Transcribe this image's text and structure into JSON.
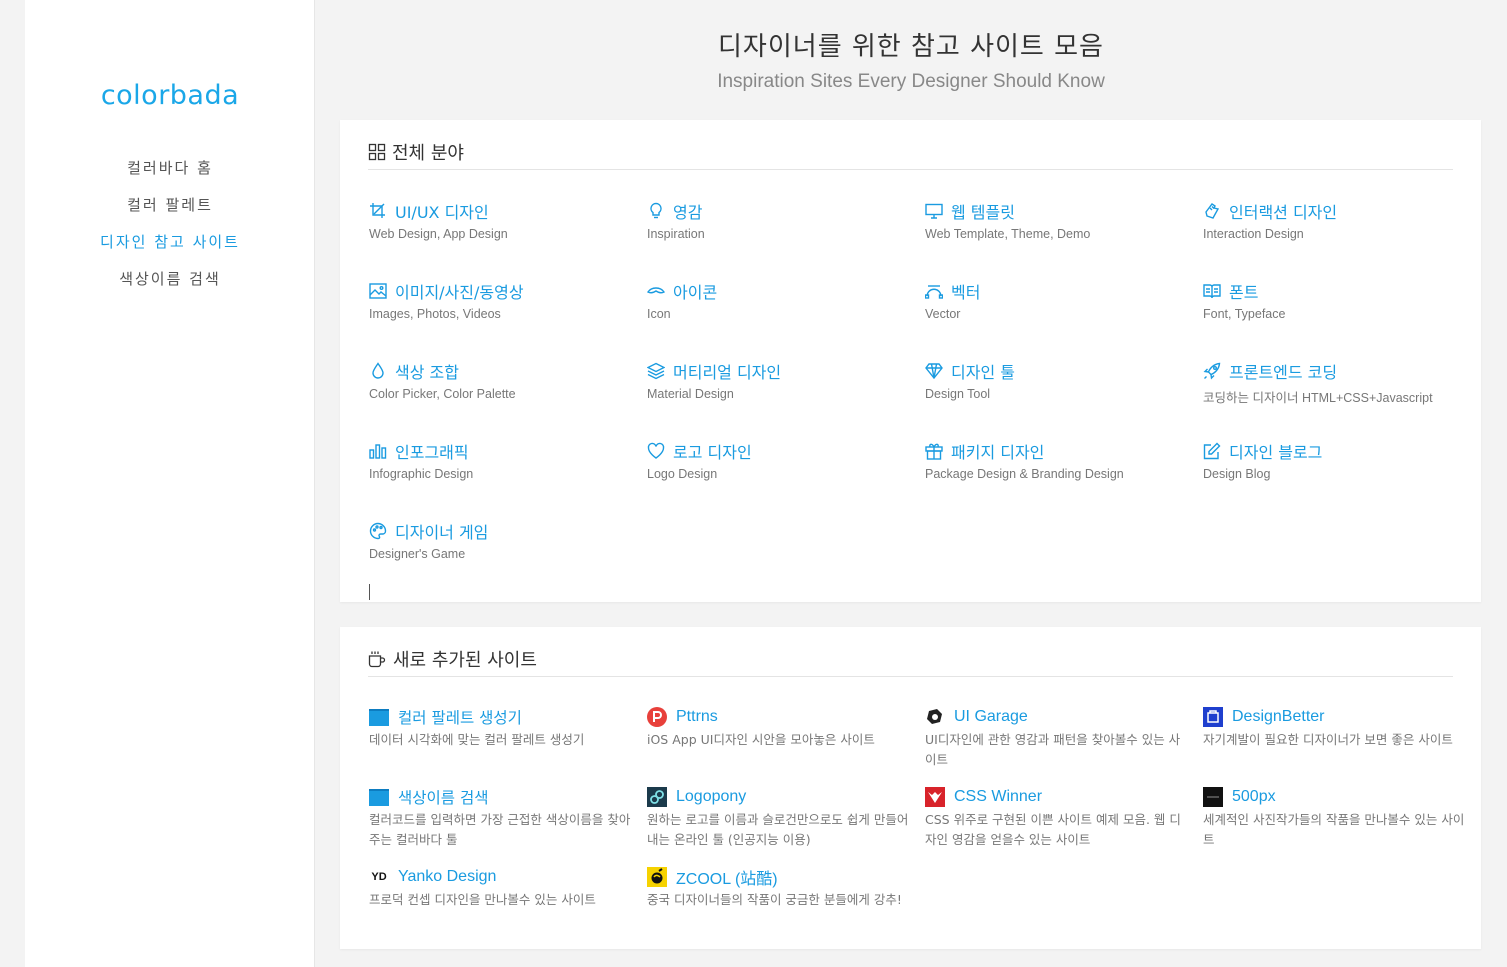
{
  "sidebar": {
    "logo": "colorbada",
    "nav": [
      {
        "label": "컬러바다 홈",
        "active": false
      },
      {
        "label": "컬러 팔레트",
        "active": false
      },
      {
        "label": "디자인 참고 사이트",
        "active": true
      },
      {
        "label": "색상이름 검색",
        "active": false
      }
    ]
  },
  "header": {
    "title": "디자이너를 위한 참고 사이트 모음",
    "subtitle": "Inspiration Sites Every Designer Should Know"
  },
  "categories": {
    "heading": "전체 분야",
    "items": [
      {
        "title": "UI/UX 디자인",
        "sub": "Web Design, App Design",
        "icon": "crop-icon"
      },
      {
        "title": "영감",
        "sub": "Inspiration",
        "icon": "lightbulb-icon"
      },
      {
        "title": "웹 템플릿",
        "sub": "Web Template, Theme, Demo",
        "icon": "monitor-icon"
      },
      {
        "title": "인터랙션 디자인",
        "sub": "Interaction Design",
        "icon": "hand-icon"
      },
      {
        "title": "이미지/사진/동영상",
        "sub": "Images, Photos, Videos",
        "icon": "image-icon"
      },
      {
        "title": "아이콘",
        "sub": "Icon",
        "icon": "eye-icon"
      },
      {
        "title": "벡터",
        "sub": "Vector",
        "icon": "bezier-icon"
      },
      {
        "title": "폰트",
        "sub": "Font, Typeface",
        "icon": "book-icon"
      },
      {
        "title": "색상 조합",
        "sub": "Color Picker, Color Palette",
        "icon": "drop-icon"
      },
      {
        "title": "머티리얼 디자인",
        "sub": "Material Design",
        "icon": "layers-icon"
      },
      {
        "title": "디자인 툴",
        "sub": "Design Tool",
        "icon": "diamond-icon"
      },
      {
        "title": "프론트엔드 코딩",
        "sub": "코딩하는 디자이너 HTML+CSS+Javascript",
        "icon": "rocket-icon"
      },
      {
        "title": "인포그래픽",
        "sub": "Infographic Design",
        "icon": "bar-chart-icon"
      },
      {
        "title": "로고 디자인",
        "sub": "Logo Design",
        "icon": "heart-icon"
      },
      {
        "title": "패키지 디자인",
        "sub": "Package Design & Branding Design",
        "icon": "gift-icon"
      },
      {
        "title": "디자인 블로그",
        "sub": "Design Blog",
        "icon": "edit-icon"
      },
      {
        "title": "디자이너 게임",
        "sub": "Designer's Game",
        "icon": "palette-icon"
      }
    ]
  },
  "new_sites": {
    "heading": "새로 추가된 사이트",
    "items": [
      {
        "title": "컬러 팔레트 생성기",
        "desc": "데이터 시각화에 맞는 컬러 팔레트 생성기",
        "icon": "colorbada-icon",
        "color": "#1a9be0"
      },
      {
        "title": "Pttrns",
        "desc": "iOS App UI디자인 시안을 모아놓은 사이트",
        "icon": "pttrns-icon",
        "color": "#e8403b"
      },
      {
        "title": "UI Garage",
        "desc": "UI디자인에 관한 영감과 패턴을 찾아볼수 있는 사이트",
        "icon": "uigarage-icon",
        "color": "#222222"
      },
      {
        "title": "DesignBetter",
        "desc": "자기계발이 필요한 디자이너가 보면 좋은 사이트",
        "icon": "designbetter-icon",
        "color": "#1f3fce"
      },
      {
        "title": "색상이름 검색",
        "desc": "컬러코드를 입력하면 가장 근접한 색상이름을 찾아주는 컬러바다 툴",
        "icon": "colorbada-icon",
        "color": "#1a9be0"
      },
      {
        "title": "Logopony",
        "desc": "원하는 로고를 이름과 슬로건만으로도 쉽게 만들어 내는 온라인 툴 (인공지능 이용)",
        "icon": "logopony-icon",
        "color": "#1b3a4b"
      },
      {
        "title": "CSS Winner",
        "desc": "CSS 위주로 구현된 이쁜 사이트 예제 모음. 웹 디자인 영감을 얻을수 있는 사이트",
        "icon": "csswinner-icon",
        "color": "#d8232a"
      },
      {
        "title": "500px",
        "desc": "세계적인 사진작가들의 작품을 만나볼수 있는 사이트",
        "icon": "500px-icon",
        "color": "#111111"
      },
      {
        "title": "Yanko Design",
        "desc": "프로덕 컨셉 디자인을 만나볼수 있는 사이트",
        "icon": "yanko-icon",
        "color": "#111111",
        "badge": "YD"
      },
      {
        "title": "ZCOOL (站酷)",
        "desc": "중국 디자이너들의 작품이 궁금한 분들에게 강추!",
        "icon": "zcool-icon",
        "color": "#f6d200"
      }
    ]
  },
  "colors": {
    "accent": "#1a9be0",
    "logo": "#1aa7e8"
  }
}
